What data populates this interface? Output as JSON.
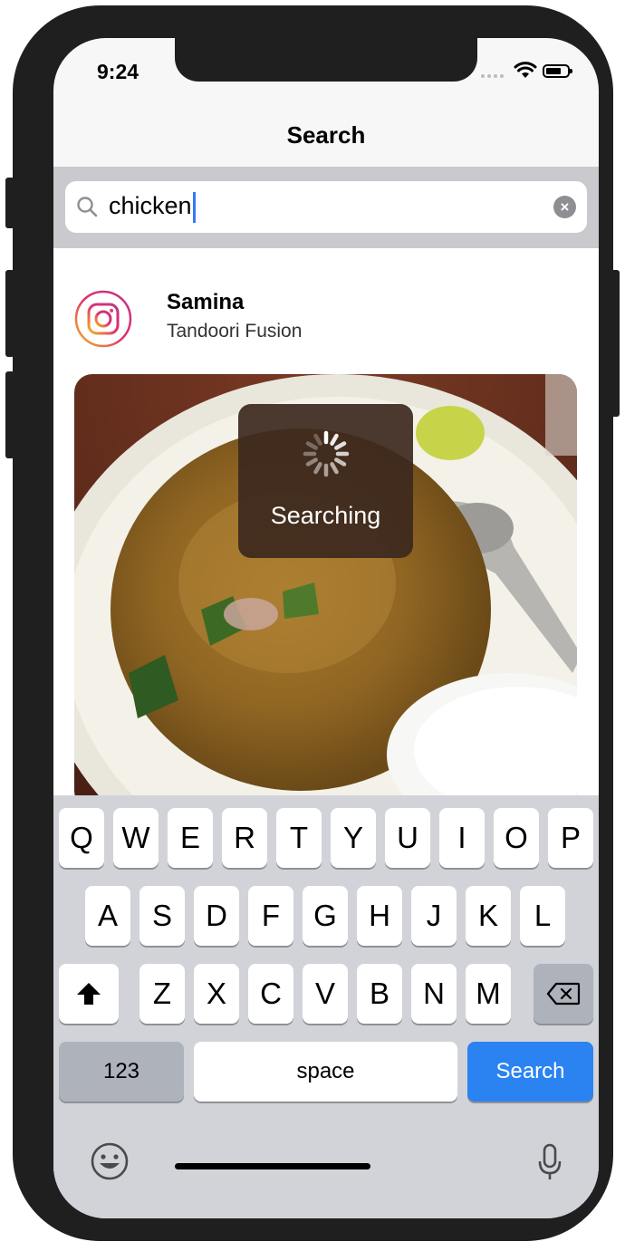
{
  "status_bar": {
    "time": "9:24"
  },
  "nav": {
    "title": "Search"
  },
  "search": {
    "value": "chicken",
    "clear_icon": "clear-icon"
  },
  "post": {
    "username": "Samina",
    "location": "Tandoori Fusion",
    "avatar_icon": "instagram-icon"
  },
  "hud": {
    "label": "Searching"
  },
  "keyboard": {
    "row1": [
      "Q",
      "W",
      "E",
      "R",
      "T",
      "Y",
      "U",
      "I",
      "O",
      "P"
    ],
    "row2": [
      "A",
      "S",
      "D",
      "F",
      "G",
      "H",
      "J",
      "K",
      "L"
    ],
    "row3": [
      "Z",
      "X",
      "C",
      "V",
      "B",
      "N",
      "M"
    ],
    "numbers_label": "123",
    "space_label": "space",
    "return_label": "Search",
    "shift_icon": "shift-icon",
    "delete_icon": "backspace-icon",
    "emoji_icon": "emoji-icon",
    "mic_icon": "microphone-icon"
  },
  "colors": {
    "accent": "#2a83f0",
    "caret": "#3478f6",
    "hud": "#3c281e"
  }
}
